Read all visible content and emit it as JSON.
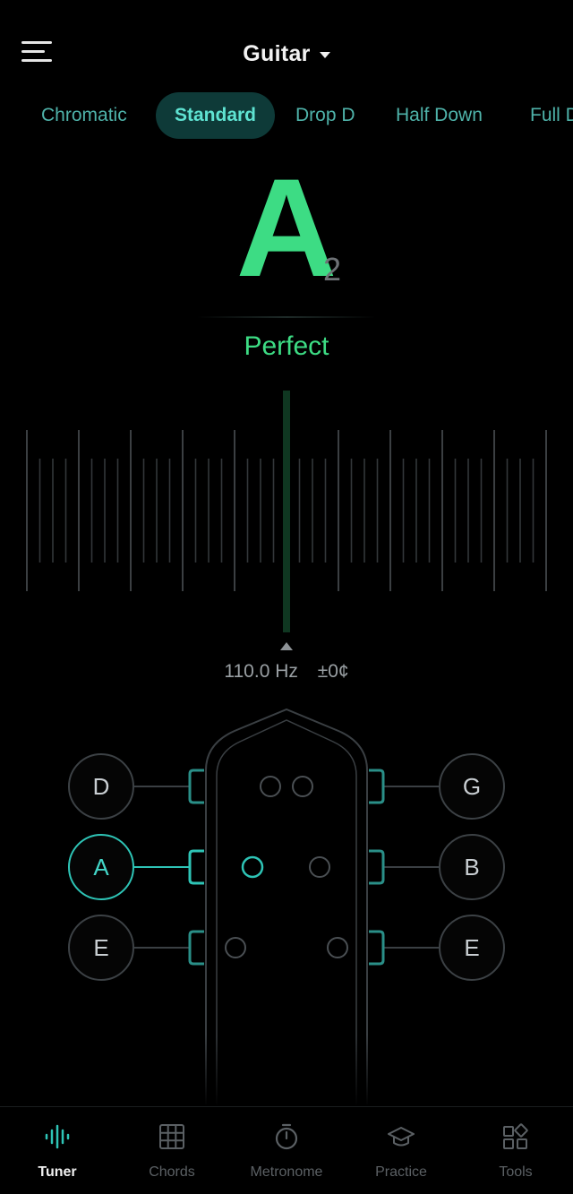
{
  "header": {
    "instrument": "Guitar"
  },
  "tunings": [
    {
      "label": "Chromatic",
      "active": false
    },
    {
      "label": "Standard",
      "active": true
    },
    {
      "label": "Drop D",
      "active": false
    },
    {
      "label": "Half Down",
      "active": false
    },
    {
      "label": "Full Down",
      "active": false
    }
  ],
  "tuner": {
    "note": "A",
    "octave": "2",
    "status": "Perfect",
    "frequency": "110.0 Hz",
    "cents": "±0¢",
    "cents_offset": 0
  },
  "strings": {
    "left": [
      {
        "note": "D",
        "active": false
      },
      {
        "note": "A",
        "active": true
      },
      {
        "note": "E",
        "active": false
      }
    ],
    "right": [
      {
        "note": "G",
        "active": false
      },
      {
        "note": "B",
        "active": false
      },
      {
        "note": "E",
        "active": false
      }
    ]
  },
  "nav": [
    {
      "label": "Tuner",
      "icon": "waveform-icon",
      "active": true
    },
    {
      "label": "Chords",
      "icon": "grid-icon",
      "active": false
    },
    {
      "label": "Metronome",
      "icon": "stopwatch-icon",
      "active": false
    },
    {
      "label": "Practice",
      "icon": "graduation-cap-icon",
      "active": false
    },
    {
      "label": "Tools",
      "icon": "widgets-icon",
      "active": false
    }
  ],
  "colors": {
    "accent": "#3ddc84",
    "teal": "#2ec4b6",
    "background": "#000000"
  }
}
